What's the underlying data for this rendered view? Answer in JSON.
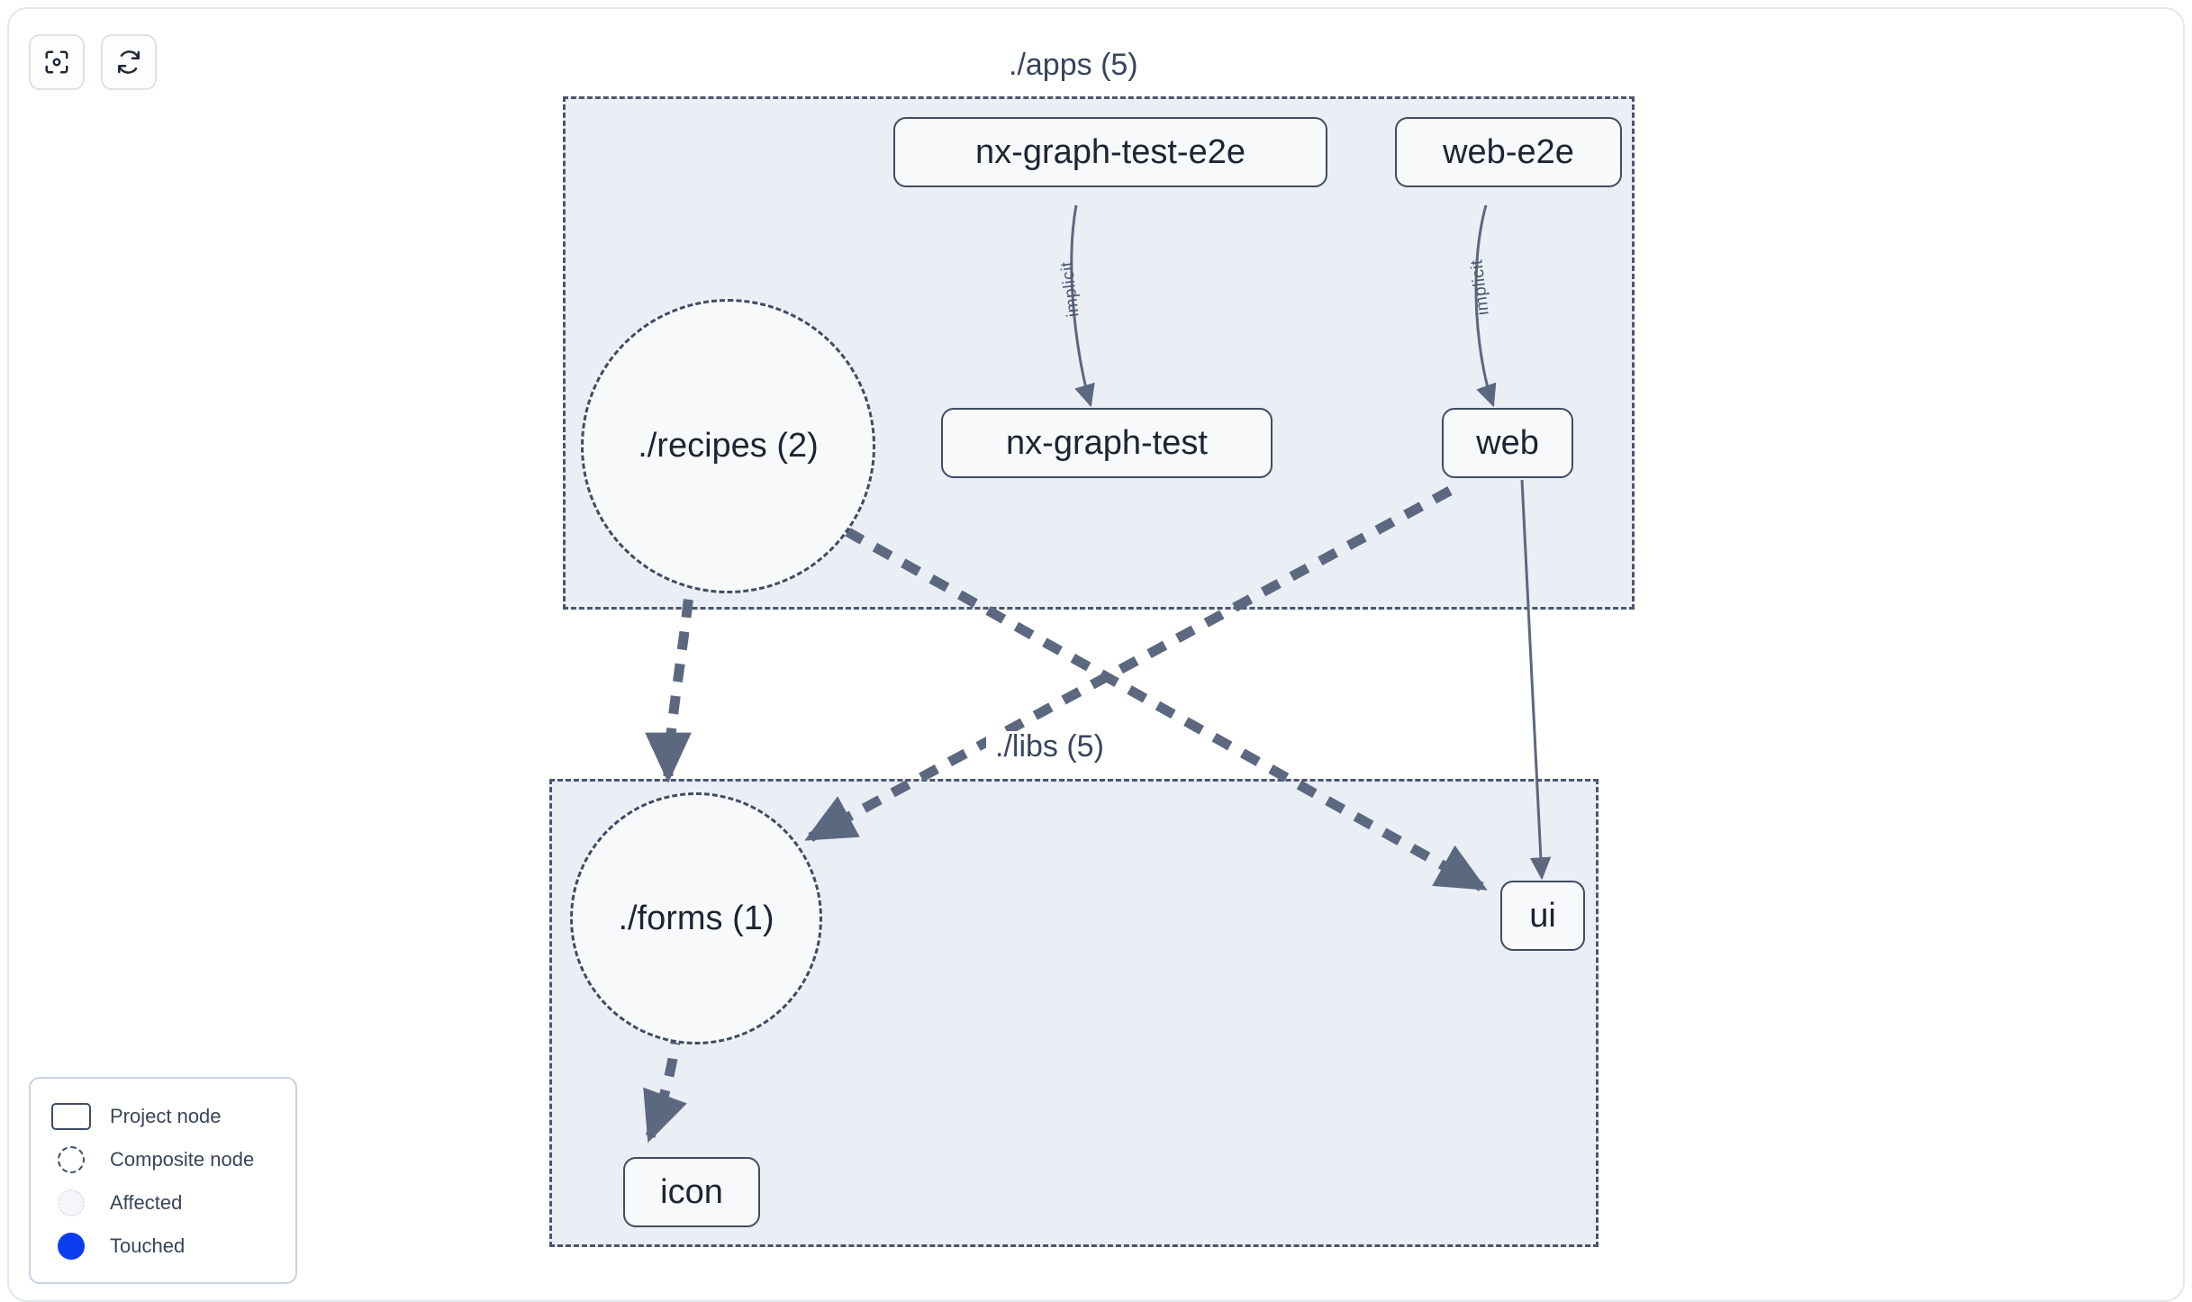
{
  "toolbar": {
    "buttons": [
      {
        "name": "focus-graph-button",
        "icon": "viewfinder-focus-icon",
        "label": ""
      },
      {
        "name": "refresh-graph-button",
        "icon": "refresh-icon",
        "label": ""
      }
    ]
  },
  "groups": [
    {
      "id": "apps",
      "label": "./apps (5)"
    },
    {
      "id": "libs",
      "label": "./libs (5)"
    }
  ],
  "nodes": {
    "nx_graph_test_e2e": "nx-graph-test-e2e",
    "web_e2e": "web-e2e",
    "recipes": "./recipes (2)",
    "nx_graph_test": "nx-graph-test",
    "web": "web",
    "forms": "./forms (1)",
    "ui": "ui",
    "icon": "icon"
  },
  "edge_labels": {
    "implicit_a": "implicit",
    "implicit_b": "implicit"
  },
  "legend": {
    "items": [
      {
        "swatch": "project-node-swatch",
        "label": "Project node"
      },
      {
        "swatch": "composite-node-swatch",
        "label": "Composite node"
      },
      {
        "swatch": "affected-swatch",
        "label": "Affected"
      },
      {
        "swatch": "touched-swatch",
        "label": "Touched"
      }
    ]
  },
  "colors": {
    "group_fill": "#eaeef5",
    "group_border": "#4a566b",
    "node_border": "#3f4c63",
    "node_fill": "#f8f9fb",
    "text": "#1d2433",
    "edge": "#5b6880",
    "touched": "#0a3df0"
  }
}
